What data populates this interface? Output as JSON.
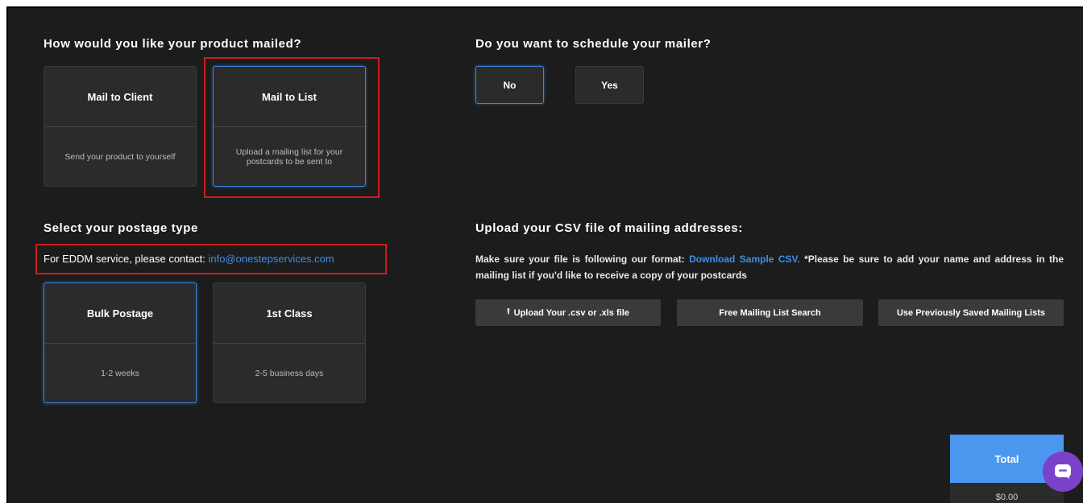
{
  "mailing": {
    "heading": "How would you like your product mailed?",
    "options": [
      {
        "title": "Mail to Client",
        "desc": "Send your product to yourself"
      },
      {
        "title": "Mail to List",
        "desc": "Upload a mailing list for your postcards to be sent to"
      }
    ],
    "selected": "Mail to List"
  },
  "schedule": {
    "heading": "Do you want to schedule your mailer?",
    "no_label": "No",
    "yes_label": "Yes",
    "selected": "No"
  },
  "postage": {
    "heading": "Select your postage type",
    "contact_prefix": "For EDDM service, please contact: ",
    "contact_email": "info@onestepservices.com",
    "options": [
      {
        "title": "Bulk Postage",
        "desc": "1-2 weeks"
      },
      {
        "title": "1st Class",
        "desc": "2-5 business days"
      }
    ],
    "selected": "Bulk Postage"
  },
  "upload": {
    "heading": "Upload your CSV file of mailing addresses:",
    "instructions_prefix": "Make sure your file is following our format: ",
    "sample_link": "Download Sample CSV.",
    "instructions_suffix": " *Please be sure to add your name and address in the mailing list if you'd like to receive a copy of your postcards",
    "upload_icon": "⭱",
    "upload_label": "Upload Your .csv or .xls file",
    "search_label": "Free Mailing List Search",
    "saved_label": "Use Previously Saved Mailing Lists"
  },
  "total": {
    "label": "Total",
    "value": "$0.00"
  },
  "colors": {
    "background": "#1c1c1c",
    "card": "#2b2b2b",
    "accent": "#3b86e0",
    "link": "#3d8fe8",
    "highlight": "#d11b1b",
    "total": "#4a97f0",
    "chat": "#7a42c9"
  },
  "icons": {
    "upload": "upload-icon",
    "chat": "chat-icon"
  }
}
